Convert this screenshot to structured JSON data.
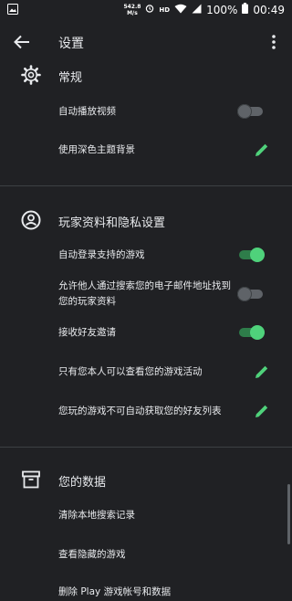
{
  "status_bar": {
    "speed_value": "542.8",
    "speed_unit": "M/s",
    "hd": "HD",
    "battery": "100%",
    "time": "00:49"
  },
  "app_bar": {
    "title": "设置"
  },
  "sections": {
    "general": {
      "title": "常规",
      "autoplay_label": "自动播放视频",
      "autoplay_on": false,
      "dark_theme_label": "使用深色主题背景"
    },
    "privacy": {
      "title": "玩家资料和隐私设置",
      "auto_signin_label": "自动登录支持的游戏",
      "auto_signin_on": true,
      "discoverable_label": "允许他人通过搜索您的电子邮件地址找到您的玩家资料",
      "discoverable_on": false,
      "friend_invites_label": "接收好友邀请",
      "friend_invites_on": true,
      "activity_label": "只有您本人可以查看您的游戏活动",
      "friends_list_label": "您玩的游戏不可自动获取您的好友列表"
    },
    "data": {
      "title": "您的数据",
      "clear_search_label": "清除本地搜索记录",
      "hidden_games_label": "查看隐藏的游戏",
      "delete_label": "删除 Play 游戏帐号和数据"
    }
  },
  "colors": {
    "background": "#202124",
    "accent": "#4fd27b",
    "text": "#e8eaed",
    "divider": "#3c4043"
  },
  "icons": [
    "image-icon",
    "signal-icon",
    "wifi-icon",
    "battery-icon",
    "back-arrow-icon",
    "more-vert-icon",
    "gear-icon",
    "account-circle-icon",
    "archive-icon",
    "pencil-icon"
  ]
}
